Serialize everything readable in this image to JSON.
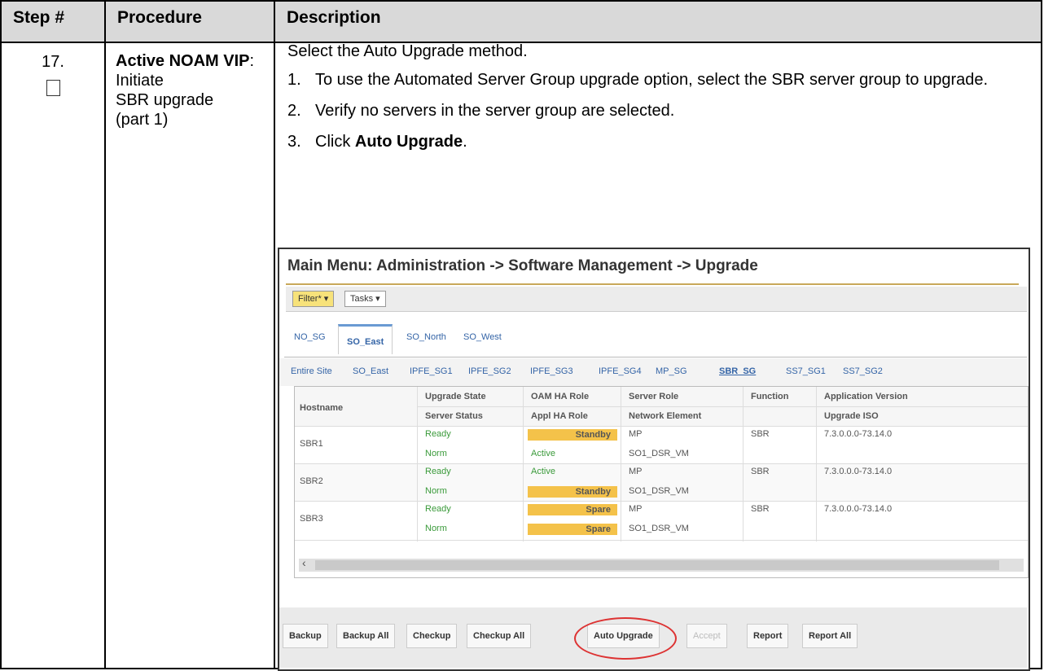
{
  "table": {
    "headers": [
      "Step #",
      "Procedure",
      "Description"
    ],
    "step_number": "17.",
    "procedure_bold": "Active NOAM VIP",
    "procedure_rest_1": ": Initiate",
    "procedure_rest_2": "SBR upgrade",
    "procedure_rest_3": "(part 1)",
    "intro": "Select the Auto Upgrade method.",
    "steps": [
      {
        "num": "1.",
        "text": "To use the Automated Server Group upgrade option, select the SBR server group to upgrade."
      },
      {
        "num": "2.",
        "text": "Verify no servers in the server group are selected."
      },
      {
        "num": "3.",
        "pre": "Click ",
        "bold": "Auto Upgrade",
        "post": "."
      }
    ]
  },
  "screenshot": {
    "title": "Main Menu: Administration -> Software Management -> Upgrade",
    "toolbar": {
      "filter": "Filter* ▾",
      "tasks": "Tasks ▾"
    },
    "tabs1": [
      "NO_SG",
      "SO_East",
      "SO_North",
      "SO_West"
    ],
    "tabs2": [
      "Entire Site",
      "SO_East",
      "IPFE_SG1",
      "IPFE_SG2",
      "IPFE_SG3",
      "IPFE_SG4",
      "MP_SG",
      "SBR_SG",
      "SS7_SG1",
      "SS7_SG2"
    ],
    "columns": {
      "hostname": "Hostname",
      "upgrade_state": "Upgrade State",
      "server_status": "Server Status",
      "oam_ha_role": "OAM HA Role",
      "appl_ha_role": "Appl HA Role",
      "server_role": "Server Role",
      "network_element": "Network Element",
      "function": "Function",
      "application_version": "Application Version",
      "upgrade_iso": "Upgrade ISO"
    },
    "rows": [
      {
        "hostname": "SBR1",
        "upgrade_state": "Ready",
        "server_status": "Norm",
        "oam_ha_role": "Standby",
        "appl_ha_role": "Active",
        "server_role": "MP",
        "network_element": "SO1_DSR_VM",
        "function": "SBR",
        "application_version": "7.3.0.0.0-73.14.0"
      },
      {
        "hostname": "SBR2",
        "upgrade_state": "Ready",
        "server_status": "Norm",
        "oam_ha_role": "Active",
        "appl_ha_role": "Standby",
        "server_role": "MP",
        "network_element": "SO1_DSR_VM",
        "function": "SBR",
        "application_version": "7.3.0.0.0-73.14.0"
      },
      {
        "hostname": "SBR3",
        "upgrade_state": "Ready",
        "server_status": "Norm",
        "oam_ha_role": "Spare",
        "appl_ha_role": "Spare",
        "server_role": "MP",
        "network_element": "SO1_DSR_VM",
        "function": "SBR",
        "application_version": "7.3.0.0.0-73.14.0"
      }
    ],
    "buttons": [
      "Backup",
      "Backup All",
      "Checkup",
      "Checkup All",
      "Auto Upgrade",
      "Accept",
      "Report",
      "Report All"
    ],
    "colors": {
      "highlight": "#f4c24a",
      "status_green": "#3a9a3a",
      "link_blue": "#3565a7",
      "callout_red": "#d33333"
    }
  }
}
